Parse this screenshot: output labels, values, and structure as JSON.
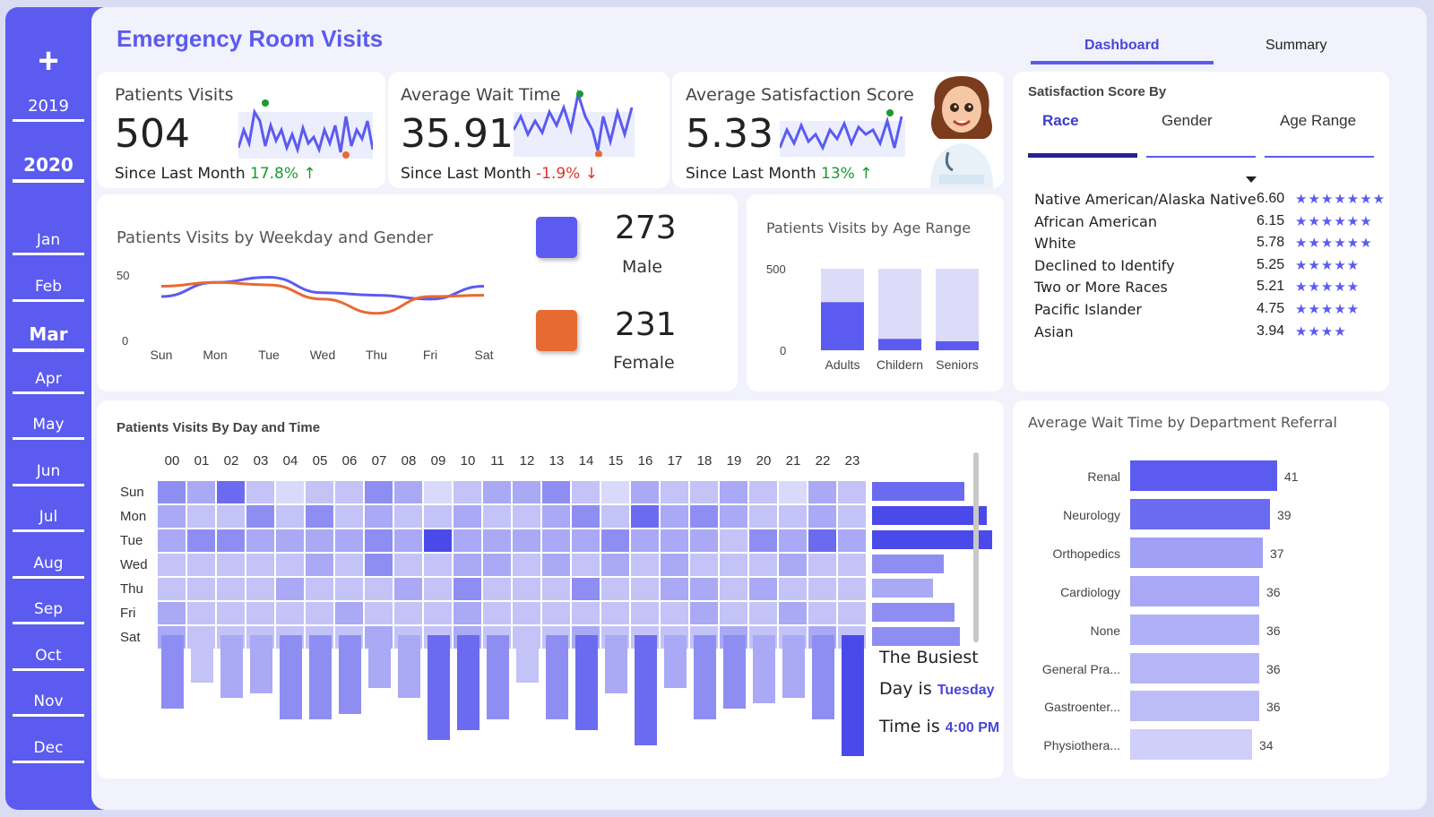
{
  "header": {
    "title": "Emergency Room Visits"
  },
  "tabs": [
    {
      "label": "Dashboard"
    },
    {
      "label": "Summary"
    }
  ],
  "sidebar": {
    "add_icon": "plus-icon",
    "years": [
      "2019",
      "2020"
    ],
    "selected_year": "2020",
    "months": [
      "Jan",
      "Feb",
      "Mar",
      "Apr",
      "May",
      "Jun",
      "Jul",
      "Aug",
      "Sep",
      "Oct",
      "Nov",
      "Dec"
    ],
    "selected_month": "Mar"
  },
  "kpis": [
    {
      "label": "Patients Visits",
      "value": "504",
      "since_label": "Since Last Month",
      "change": "17.8% ↑",
      "trend": "up"
    },
    {
      "label": "Average Wait Time",
      "value": "35.91",
      "since_label": "Since Last Month",
      "change": "-1.9% ↓",
      "trend": "down"
    },
    {
      "label": "Average Satisfaction Score",
      "value": "5.33",
      "since_label": "Since Last Month",
      "change": "13% ↑",
      "trend": "up"
    }
  ],
  "mascot_icon": "nurse-avatar-icon",
  "colors": {
    "accent": "#5b5bf0",
    "male": "#5b5bf0",
    "female": "#e86a33",
    "up": "#1a9b2d",
    "down": "#e0342a"
  },
  "weekday_gender": {
    "title": "Patients Visits by Weekday and Gender",
    "male_total": "273",
    "male_label": "Male",
    "female_total": "231",
    "female_label": "Female",
    "chart_data": {
      "type": "line",
      "categories": [
        "Sun",
        "Mon",
        "Tue",
        "Wed",
        "Thu",
        "Fri",
        "Sat"
      ],
      "ylim": [
        0,
        50
      ],
      "yticks": [
        "50",
        "0"
      ],
      "series": [
        {
          "name": "Male",
          "values": [
            34,
            45,
            49,
            37,
            35,
            32,
            42
          ]
        },
        {
          "name": "Female",
          "values": [
            42,
            45,
            43,
            32,
            21,
            34,
            35
          ]
        }
      ]
    }
  },
  "age_range": {
    "title": "Patients Visits by Age Range",
    "chart_data": {
      "type": "bar",
      "categories": [
        "Adults",
        "Childern",
        "Seniors"
      ],
      "ylim": [
        0,
        500
      ],
      "yticks": [
        "500",
        "0"
      ],
      "values": [
        295,
        70,
        55
      ],
      "total": 504
    }
  },
  "satisfaction": {
    "title": "Satisfaction Score By",
    "tabs": [
      "Race",
      "Gender",
      "Age Range"
    ],
    "active_tab": "Race",
    "sort_icon": "sort-down-icon",
    "rows": [
      {
        "label": "Native American/Alaska Native",
        "score": "6.60",
        "stars": "★★★★★★★"
      },
      {
        "label": "African American",
        "score": "6.15",
        "stars": "★★★★★★"
      },
      {
        "label": "White",
        "score": "5.78",
        "stars": "★★★★★★"
      },
      {
        "label": "Declined to Identify",
        "score": "5.25",
        "stars": "★★★★★"
      },
      {
        "label": "Two or More Races",
        "score": "5.21",
        "stars": "★★★★★"
      },
      {
        "label": "Pacific Islander",
        "score": "4.75",
        "stars": "★★★★★"
      },
      {
        "label": "Asian",
        "score": "3.94",
        "stars": "★★★★"
      }
    ]
  },
  "heatmap": {
    "title": "Patients Visits By Day and Time",
    "hours": [
      "00",
      "01",
      "02",
      "03",
      "04",
      "05",
      "06",
      "07",
      "08",
      "09",
      "10",
      "11",
      "12",
      "13",
      "14",
      "15",
      "16",
      "17",
      "18",
      "19",
      "20",
      "21",
      "22",
      "23"
    ],
    "days": [
      "Sun",
      "Mon",
      "Tue",
      "Wed",
      "Thu",
      "Fri",
      "Sat"
    ],
    "chart_data": {
      "type": "heatmap",
      "x": [
        "00",
        "01",
        "02",
        "03",
        "04",
        "05",
        "06",
        "07",
        "08",
        "09",
        "10",
        "11",
        "12",
        "13",
        "14",
        "15",
        "16",
        "17",
        "18",
        "19",
        "20",
        "21",
        "22",
        "23"
      ],
      "y": [
        "Sun",
        "Mon",
        "Tue",
        "Wed",
        "Thu",
        "Fri",
        "Sat"
      ],
      "values": [
        [
          4,
          3,
          5,
          2,
          1,
          2,
          2,
          4,
          3,
          1,
          2,
          3,
          3,
          4,
          2,
          1,
          3,
          2,
          2,
          3,
          2,
          1,
          3,
          2
        ],
        [
          3,
          2,
          2,
          4,
          2,
          4,
          2,
          3,
          2,
          2,
          3,
          2,
          2,
          3,
          4,
          2,
          5,
          3,
          4,
          3,
          2,
          2,
          3,
          2
        ],
        [
          3,
          4,
          4,
          3,
          3,
          3,
          3,
          4,
          3,
          6,
          3,
          3,
          3,
          3,
          3,
          4,
          3,
          3,
          3,
          2,
          4,
          3,
          5,
          3
        ],
        [
          2,
          2,
          2,
          2,
          2,
          3,
          2,
          4,
          2,
          2,
          3,
          3,
          2,
          3,
          2,
          3,
          2,
          3,
          2,
          2,
          2,
          3,
          2,
          2
        ],
        [
          2,
          2,
          2,
          2,
          3,
          2,
          2,
          2,
          3,
          2,
          4,
          2,
          2,
          2,
          4,
          2,
          2,
          3,
          3,
          2,
          3,
          2,
          2,
          2
        ],
        [
          3,
          2,
          2,
          2,
          2,
          2,
          3,
          2,
          2,
          2,
          3,
          2,
          2,
          2,
          2,
          2,
          2,
          2,
          3,
          2,
          2,
          3,
          2,
          2
        ],
        [
          3,
          2,
          2,
          2,
          2,
          2,
          2,
          3,
          2,
          2,
          3,
          2,
          2,
          2,
          3,
          2,
          2,
          2,
          2,
          3,
          2,
          2,
          3,
          2
        ]
      ],
      "hour_totals": [
        14,
        9,
        12,
        11,
        16,
        16,
        15,
        10,
        12,
        20,
        18,
        16,
        9,
        16,
        18,
        11,
        21,
        10,
        16,
        14,
        13,
        12,
        16,
        23
      ],
      "day_totals": [
        71,
        88,
        92,
        55,
        47,
        63,
        67
      ]
    },
    "busiest_line1": "The Busiest",
    "busiest_day_prefix": "Day is",
    "busiest_day": "Tuesday",
    "busiest_time_prefix": "Time is",
    "busiest_time": "4:00 PM"
  },
  "departments": {
    "title": "Average Wait Time by Department Referral",
    "chart_data": {
      "type": "bar",
      "orientation": "horizontal",
      "categories": [
        "Renal",
        "Neurology",
        "Orthopedics",
        "Cardiology",
        "None",
        "General Pra...",
        "Gastroenter...",
        "Physiothera..."
      ],
      "values": [
        41,
        39,
        37,
        36,
        36,
        36,
        36,
        34
      ],
      "xlim": [
        0,
        41
      ]
    }
  }
}
